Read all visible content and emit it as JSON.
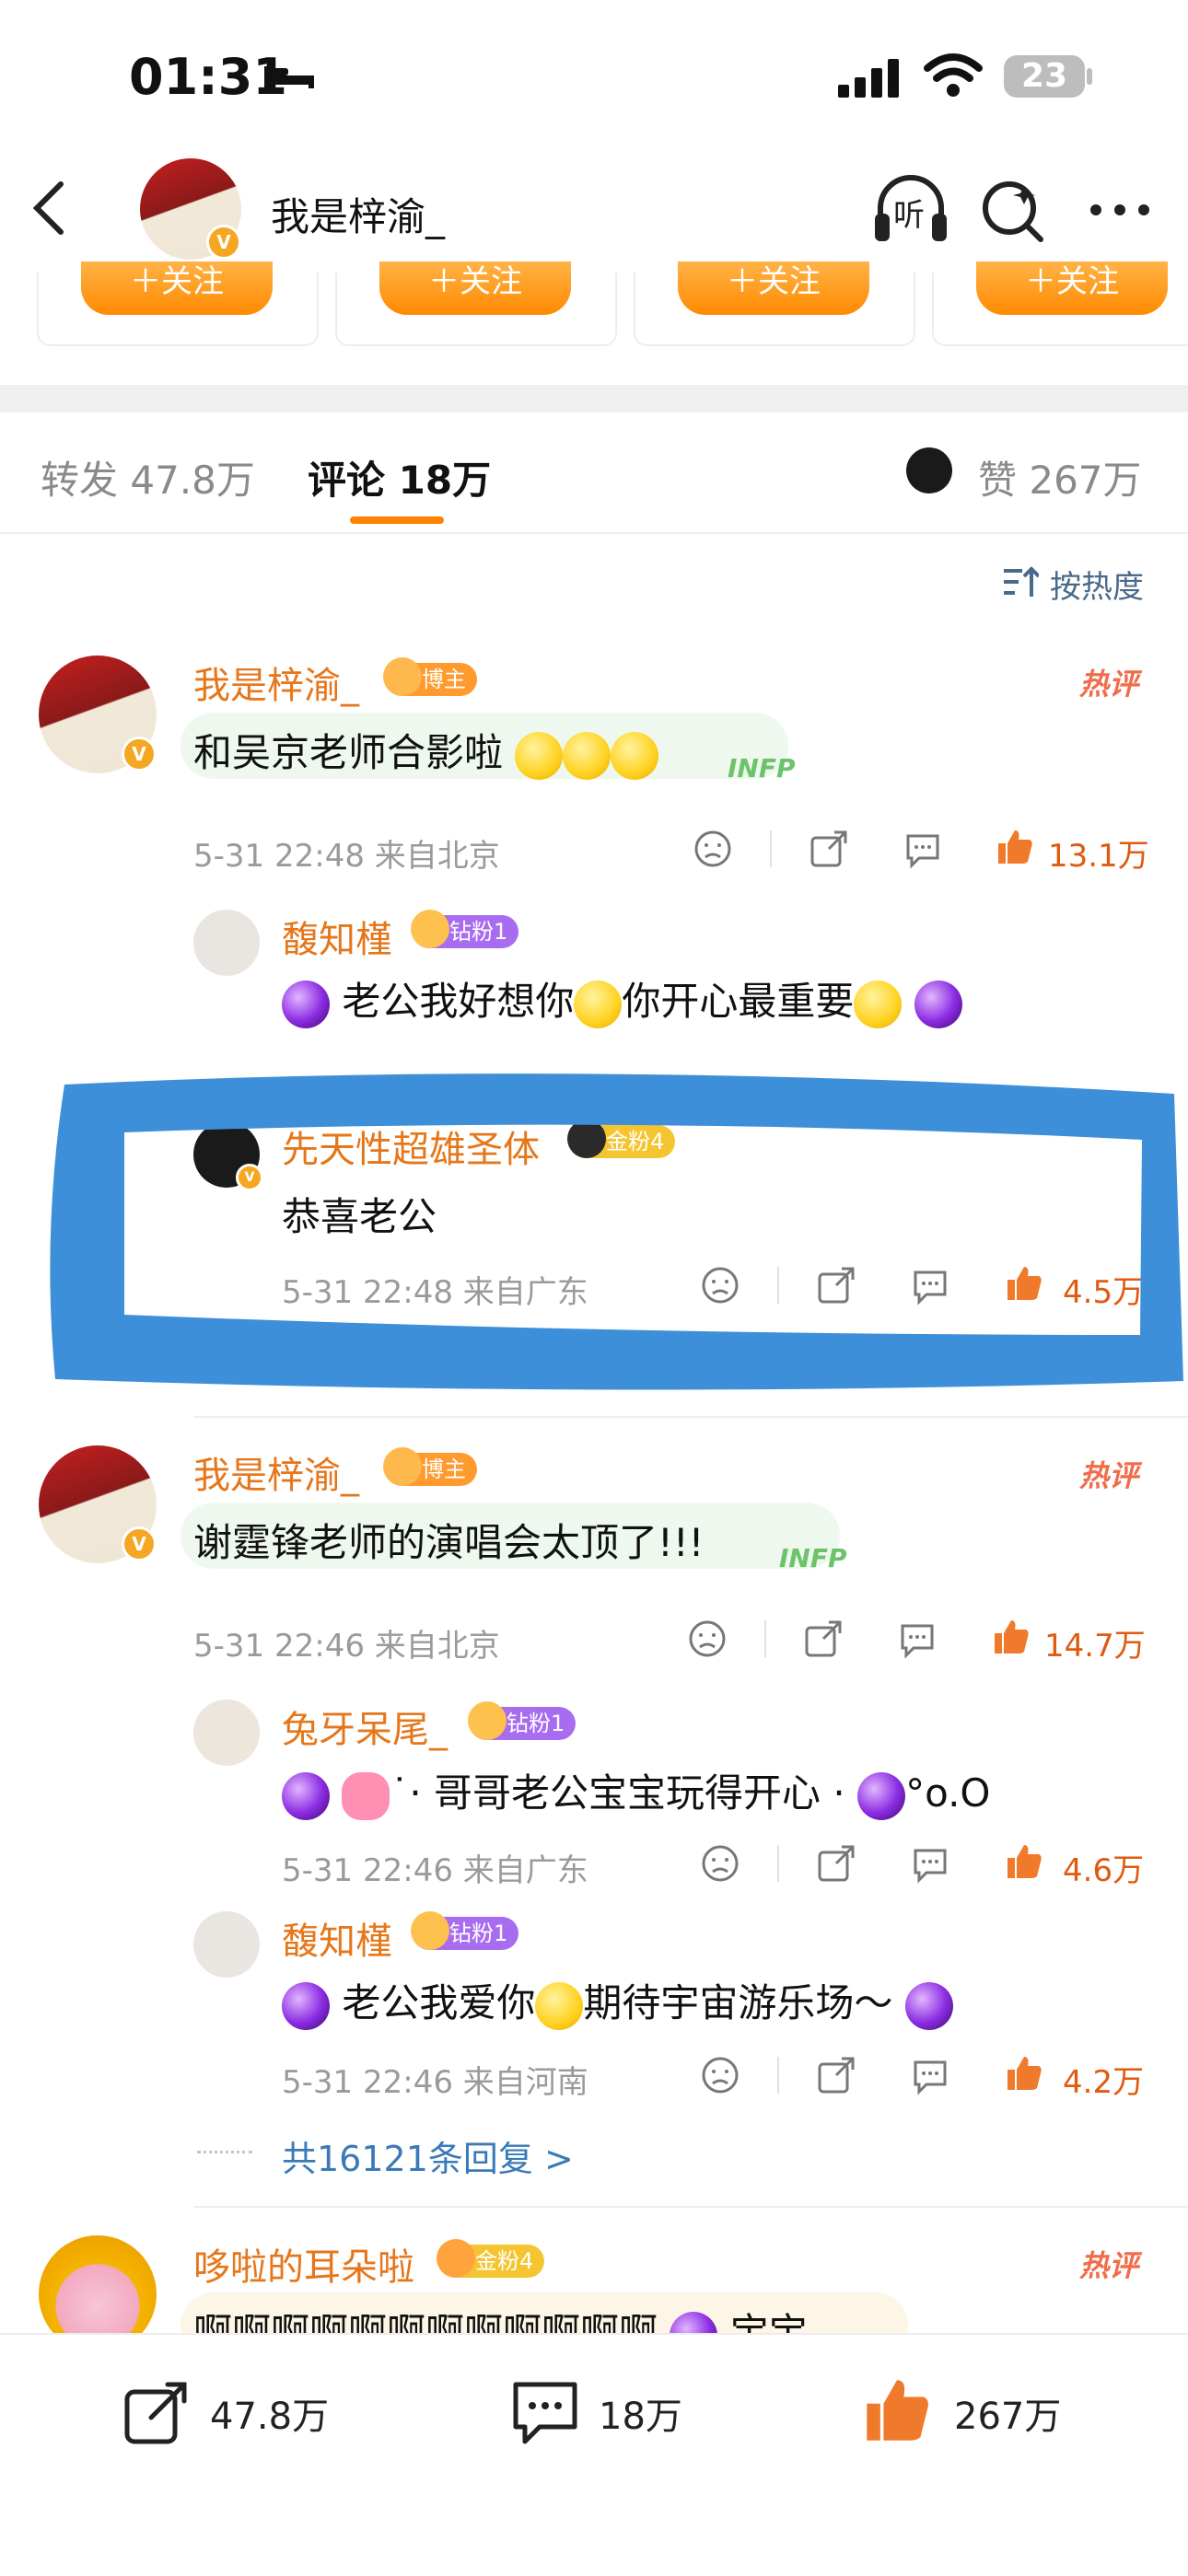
{
  "status_bar": {
    "time": "01:31",
    "battery": "23"
  },
  "nav": {
    "title": "我是梓渝_",
    "listen_label": "听"
  },
  "follow_buttons": [
    "＋关注",
    "＋关注",
    "＋关注",
    "＋关注"
  ],
  "tabs": {
    "repost": "转发 47.8万",
    "comments": "评论 18万",
    "likes": "赞 267万"
  },
  "sort_label": "按热度",
  "comments": [
    {
      "user": "我是梓渝_",
      "badge": "博主",
      "badge_color": "#ff9a2e",
      "hot": "热评",
      "text": "和吴京老师合影啦",
      "tag": "INFP",
      "time": "5-31 22:48",
      "location": "来自北京",
      "likes": "13.1万",
      "replies": [
        {
          "user": "馥知槿",
          "badge": "钻粉1",
          "badge_color": "#a86cf0",
          "text": "老公我好想你",
          "text2": "你开心最重要"
        },
        {
          "user": "先天性超雄圣体",
          "badge": "金粉4",
          "badge_color": "#f5c531",
          "text": "恭喜老公",
          "time": "5-31 22:48",
          "location": "来自广东",
          "likes": "4.5万"
        }
      ]
    },
    {
      "user": "我是梓渝_",
      "badge": "博主",
      "badge_color": "#ff9a2e",
      "hot": "热评",
      "text": "谢霆锋老师的演唱会太顶了!!!",
      "tag": "INFP",
      "time": "5-31 22:46",
      "location": "来自北京",
      "likes": "14.7万",
      "replies": [
        {
          "user": "兔牙呆尾_",
          "badge": "钻粉1",
          "badge_color": "#a86cf0",
          "text": "˙· 哥哥老公宝宝玩得开心 · ",
          "text2": "°o.O",
          "time": "5-31 22:46",
          "location": "来自广东",
          "likes": "4.6万"
        },
        {
          "user": "馥知槿",
          "badge": "钻粉1",
          "badge_color": "#a86cf0",
          "text": "老公我爱你",
          "text2": "期待宇宙游乐场～",
          "time": "5-31 22:46",
          "location": "来自河南",
          "likes": "4.2万"
        }
      ],
      "more_replies": "共16121条回复 >"
    },
    {
      "user": "哆啦的耳朵啦",
      "badge": "金粉4",
      "badge_color": "#f5c531",
      "hot": "热评",
      "text": "啊啊啊啊啊啊啊啊啊啊啊啊",
      "text2": "宝宝"
    }
  ],
  "bottom_bar": {
    "reposts": "47.8万",
    "comments": "18万",
    "likes": "267万"
  },
  "colors": {
    "accent": "#ff8200",
    "username": "#e6761a",
    "highlight": "#3d8fd9"
  }
}
